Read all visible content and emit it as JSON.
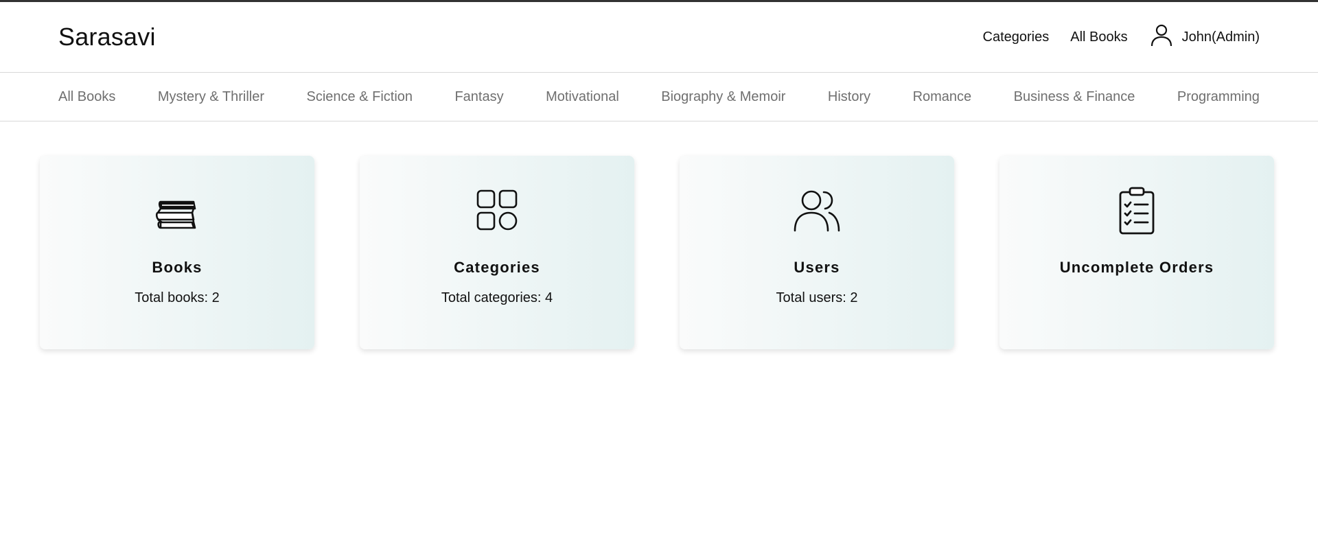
{
  "header": {
    "brand": "Sarasavi",
    "nav": {
      "categories": "Categories",
      "all_books": "All Books"
    },
    "user": {
      "name": "John(Admin)",
      "icon": "user-icon"
    }
  },
  "category_nav": [
    "All Books",
    "Mystery & Thriller",
    "Science & Fiction",
    "Fantasy",
    "Motivational",
    "Biography & Memoir",
    "History",
    "Romance",
    "Business & Finance",
    "Programming"
  ],
  "cards": [
    {
      "title": "Books",
      "subtitle": "Total books: 2",
      "icon": "books-stack-icon"
    },
    {
      "title": "Categories",
      "subtitle": "Total categories: 4",
      "icon": "categories-grid-icon"
    },
    {
      "title": "Users",
      "subtitle": "Total users: 2",
      "icon": "users-icon"
    },
    {
      "title": "Uncomplete Orders",
      "subtitle": "",
      "icon": "clipboard-checklist-icon"
    }
  ],
  "colors": {
    "card_gradient_start": "#fafbfb",
    "card_gradient_end": "#e4f1f1",
    "category_text": "#6f6f6f",
    "top_border": "#333333"
  }
}
